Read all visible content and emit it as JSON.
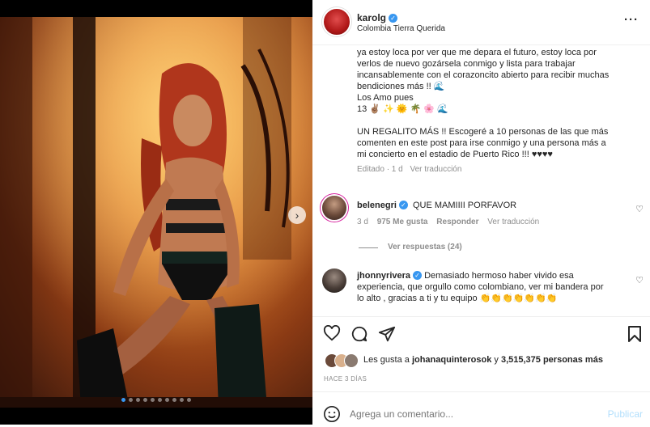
{
  "post": {
    "username": "karolg",
    "location": "Colombia Tierra Querida",
    "more_label": "···",
    "caption_lines": [
      "ya estoy loca por ver que me depara el futuro, estoy loca por",
      "verlos de nuevo gozársela conmigo y lista para trabajar",
      "incansablemente con el corazoncito abierto para recibir muchas",
      "bendiciones más !! 🌊",
      "Los Amo pues",
      "13 ✌🏽 ✨ 🌞 🌴 🌸 🌊"
    ],
    "caption2_lines": [
      "UN REGALITO MÁS !! Escogeré a 10 personas de las que más",
      "comenten en este post para irse conmigo y una persona más a",
      "mi concierto en el estadio de Puerto Rico !!! ♥♥♥♥"
    ],
    "meta": "Editado · 1 d",
    "see_translation": "Ver traducción"
  },
  "comments": [
    {
      "username": "belenegri",
      "text": "QUE MAMIIII PORFAVOR",
      "time": "3 d",
      "likes": "975 Me gusta",
      "reply": "Responder",
      "translate": "Ver traducción",
      "view_replies": "Ver respuestas (24)"
    },
    {
      "username": "jhonnyrivera",
      "text_lines": [
        "Demasiado hermoso haber vivido esa",
        "experiencia, que orgullo como colombiano, ver mi bandera por",
        "lo alto , gracias a ti y tu equipo 👏👏👏👏👏👏👏"
      ]
    }
  ],
  "likes": {
    "prefix": "Les gusta a",
    "user": "johanaquinterosok",
    "middle": "y",
    "count": "3,515,375 personas más"
  },
  "date_label": "HACE 3 DÍAS",
  "comment_box": {
    "placeholder": "Agrega un comentario...",
    "publish": "Publicar"
  },
  "icons": {
    "like": "heart-icon",
    "comment": "comment-icon",
    "share": "send-icon",
    "save": "bookmark-icon",
    "emoji": "emoji-icon",
    "next": "chevron-right-icon"
  },
  "carousel": {
    "total": 10,
    "active": 0
  },
  "colors": {
    "accent": "#3897f0",
    "publish": "#b2dffc"
  }
}
